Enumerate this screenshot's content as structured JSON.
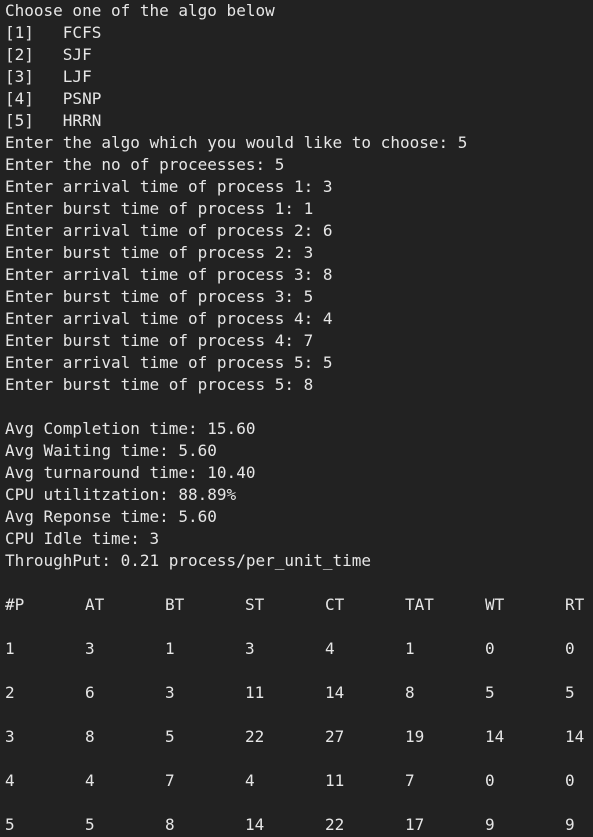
{
  "terminal": {
    "menu": {
      "prompt": "Choose one of the algo below",
      "options": [
        "[1]   FCFS",
        "[2]   SJF",
        "[3]   LJF",
        "[4]   PSNP",
        "[5]   HRRN"
      ]
    },
    "inputs": [
      "Enter the algo which you would like to choose: 5",
      "Enter the no of proceesses: 5",
      "Enter arrival time of process 1: 3",
      "Enter burst time of process 1: 1",
      "Enter arrival time of process 2: 6",
      "Enter burst time of process 2: 3",
      "Enter arrival time of process 3: 8",
      "Enter burst time of process 3: 5",
      "Enter arrival time of process 4: 4",
      "Enter burst time of process 4: 7",
      "Enter arrival time of process 5: 5",
      "Enter burst time of process 5: 8"
    ],
    "stats": [
      "Avg Completion time: 15.60",
      "Avg Waiting time: 5.60",
      "Avg turnaround time: 10.40",
      "CPU utilitzation: 88.89%",
      "Avg Reponse time: 5.60",
      "CPU Idle time: 3",
      "ThroughPut: 0.21 process/per_unit_time"
    ],
    "table": {
      "headers": [
        "#P",
        "AT",
        "BT",
        "ST",
        "CT",
        "TAT",
        "WT",
        "RT"
      ],
      "rows": [
        [
          "1",
          "3",
          "1",
          "3",
          "4",
          "1",
          "0",
          "0"
        ],
        [
          "2",
          "6",
          "3",
          "11",
          "14",
          "8",
          "5",
          "5"
        ],
        [
          "3",
          "8",
          "5",
          "22",
          "27",
          "19",
          "14",
          "14"
        ],
        [
          "4",
          "4",
          "7",
          "4",
          "11",
          "7",
          "0",
          "0"
        ],
        [
          "5",
          "5",
          "8",
          "14",
          "22",
          "17",
          "9",
          "9"
        ]
      ]
    }
  }
}
